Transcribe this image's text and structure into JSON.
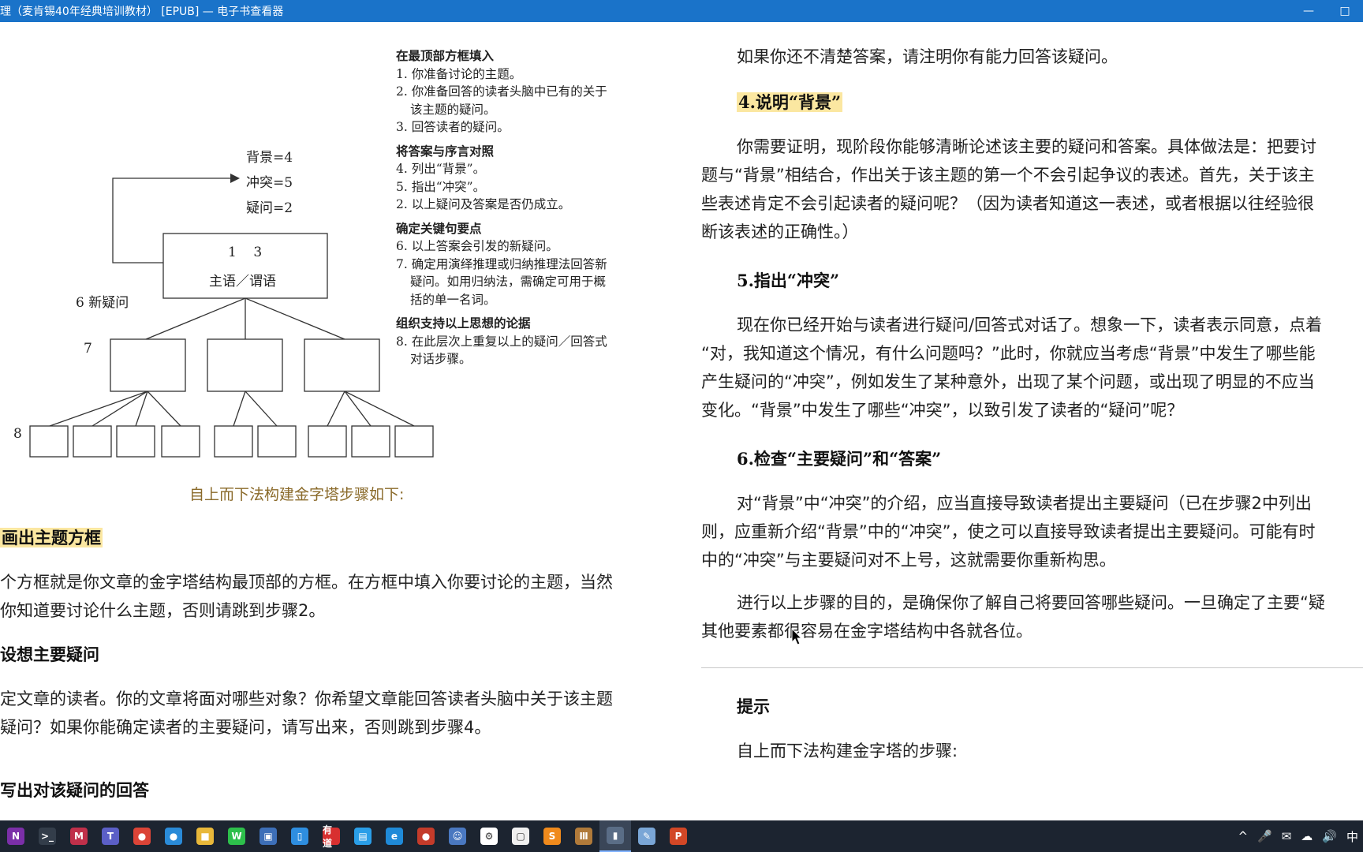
{
  "window": {
    "title": "理（麦肯锡40年经典培训教材） [EPUB] — 电子书查看器",
    "minimize_glyph": "—",
    "maximize_glyph": "□"
  },
  "left_page": {
    "diagram": {
      "top_labels": [
        "背景=4",
        "冲突=5",
        "疑问=2"
      ],
      "box_numbers": "1    3",
      "box_text": "主语／谓语",
      "label_6": "6  新疑问",
      "label_7": "7",
      "label_8": "8"
    },
    "notes": [
      {
        "heading": "在最顶部方框填入",
        "items": [
          "1. 你准备讨论的主题。",
          "2. 你准备回答的读者头脑中已有的关于该主题的疑问。",
          "3. 回答读者的疑问。"
        ]
      },
      {
        "heading": "将答案与序言对照",
        "items": [
          "4. 列出“背景”。",
          "5. 指出“冲突”。",
          "2. 以上疑问及答案是否仍成立。"
        ]
      },
      {
        "heading": "确定关键句要点",
        "items": [
          "6. 以上答案会引发的新疑问。",
          "7. 确定用演绎推理或归纳推理法回答新疑问。如用归纳法，需确定可用于概括的单一名词。"
        ]
      },
      {
        "heading": "组织支持以上思想的论据",
        "items": [
          "8. 在此层次上重复以上的疑问／回答式对话步骤。"
        ]
      }
    ],
    "caption": "自上而下法构建金字塔步骤如下:",
    "section1_heading": "画出主题方框",
    "section1_body_1": "个方框就是你文章的金字塔结构最顶部的方框。在方框中填入你要讨论的主题，当然",
    "section1_body_2": "你知道要讨论什么主题，否则请跳到步骤2。",
    "section2_heading": "设想主要疑问",
    "section2_body_1": "定文章的读者。你的文章将面对哪些对象？你希望文章能回答读者头脑中关于该主题",
    "section2_body_2": "疑问？如果你能确定读者的主要疑问，请写出来，否则跳到步骤4。",
    "section3_heading": "写出对该疑问的回答"
  },
  "right_page": {
    "p_intro": "如果你还不清楚答案，请注明你有能力回答该疑问。",
    "h4": "4.说明“背景”",
    "p4": [
      "你需要证明，现阶段你能够清晰论述该主要的疑问和答案。具体做法是：把要讨",
      "题与“背景”相结合，作出关于该主题的第一个不会引起争议的表述。首先，关于该主",
      "些表述肯定不会引起读者的疑问呢？（因为读者知道这一表述，或者根据以往经验很",
      "断该表述的正确性。）"
    ],
    "h5": "5.指出“冲突”",
    "p5": [
      "现在你已经开始与读者进行疑问/回答式对话了。想象一下，读者表示同意，点着",
      "“对，我知道这个情况，有什么问题吗？”此时，你就应当考虑“背景”中发生了哪些能",
      "产生疑问的“冲突”，例如发生了某种意外，出现了某个问题，或出现了明显的不应当",
      "变化。“背景”中发生了哪些“冲突”，以致引发了读者的“疑问”呢？"
    ],
    "h6": "6.检查“主要疑问”和“答案”",
    "p6": [
      "对“背景”中“冲突”的介绍，应当直接导致读者提出主要疑问（已在步骤2中列出",
      "则，应重新介绍“背景”中的“冲突”，使之可以直接导致读者提出主要疑问。可能有时",
      "中的“冲突”与主要疑问对不上号，这就需要你重新构思。"
    ],
    "p7": [
      "进行以上步骤的目的，是确保你了解自己将要回答哪些疑问。一旦确定了主要“疑",
      "其他要素都很容易在金字塔结构中各就各位。"
    ],
    "tip_heading": "提示",
    "tip_body": "自上而下法构建金字塔的步骤:"
  },
  "taskbar": {
    "apps": [
      {
        "name": "onenote",
        "glyph": "N",
        "color": "#7b2fa8"
      },
      {
        "name": "terminal",
        "glyph": ">_",
        "color": "#333d4a"
      },
      {
        "name": "app-red",
        "glyph": "M",
        "color": "#c0304a"
      },
      {
        "name": "teams",
        "glyph": "T",
        "color": "#5b5fc7"
      },
      {
        "name": "chrome",
        "glyph": "●",
        "color": "#db4437"
      },
      {
        "name": "chrome-alt",
        "glyph": "●",
        "color": "#2a8bd8"
      },
      {
        "name": "file-explorer",
        "glyph": "■",
        "color": "#e8b83a"
      },
      {
        "name": "wechat",
        "glyph": "W",
        "color": "#2dbf4b"
      },
      {
        "name": "save-app",
        "glyph": "▣",
        "color": "#3d6fb8"
      },
      {
        "name": "phone-app",
        "glyph": "▯",
        "color": "#2e8ee0"
      },
      {
        "name": "youdao",
        "glyph": "有道",
        "color": "#d83030"
      },
      {
        "name": "store",
        "glyph": "▤",
        "color": "#2a9ee8"
      },
      {
        "name": "edge",
        "glyph": "e",
        "color": "#1f8ad8"
      },
      {
        "name": "app-fruit",
        "glyph": "●",
        "color": "#c43b2a"
      },
      {
        "name": "app-bot",
        "glyph": "☺",
        "color": "#4a78c0"
      },
      {
        "name": "app-net",
        "glyph": "⚙",
        "color": "#ffffff"
      },
      {
        "name": "app-doc",
        "glyph": "▢",
        "color": "#f0f0f0"
      },
      {
        "name": "sublime",
        "glyph": "S",
        "color": "#f08a1c"
      },
      {
        "name": "library",
        "glyph": "Ⅲ",
        "color": "#b07a3a"
      },
      {
        "name": "ebook-viewer",
        "glyph": "▮",
        "color": "#5a6d86"
      },
      {
        "name": "notes-app",
        "glyph": "✎",
        "color": "#7aa6d6"
      },
      {
        "name": "powerpoint",
        "glyph": "P",
        "color": "#d24726"
      }
    ],
    "active_index": 19,
    "tray": {
      "chevron": "^",
      "ime": "中"
    }
  }
}
